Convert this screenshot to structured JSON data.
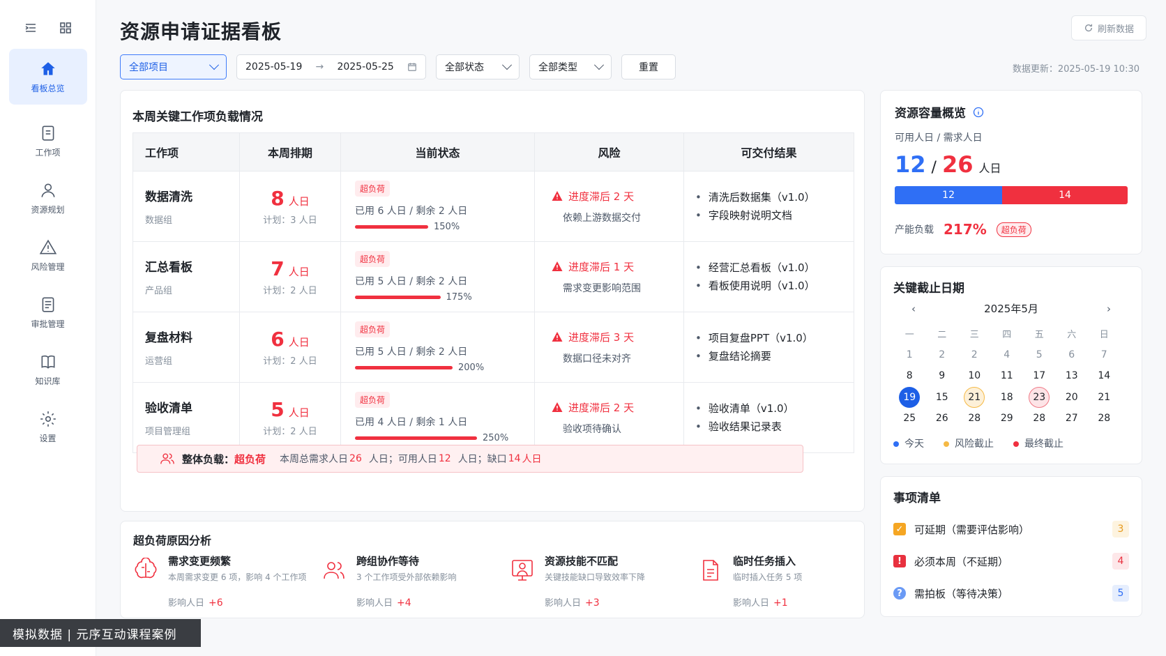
{
  "sidebar": {
    "items": [
      {
        "label": "看板总览",
        "icon": "home-icon"
      },
      {
        "label": "工作项",
        "icon": "file-icon"
      },
      {
        "label": "资源规划",
        "icon": "user-icon"
      },
      {
        "label": "风险管理",
        "icon": "warning-icon"
      },
      {
        "label": "审批管理",
        "icon": "document-icon"
      },
      {
        "label": "知识库",
        "icon": "book-icon"
      },
      {
        "label": "设置",
        "icon": "gear-icon"
      }
    ]
  },
  "header": {
    "title": "资源申请证据看板",
    "refresh_label": "刷新数据"
  },
  "filters": {
    "project": "全部项目",
    "date_start": "2025-05-19",
    "date_end": "2025-05-25",
    "status": "全部状态",
    "type": "全部类型",
    "reset_label": "重置",
    "updated": "数据更新：2025-05-19 10:30"
  },
  "workload": {
    "title": "本周关键工作项负载情况",
    "headers": [
      "工作项",
      "本周排期",
      "当前状态",
      "风险",
      "可交付结果"
    ],
    "rows": [
      {
        "name": "数据清洗",
        "team": "数据组",
        "days": "8",
        "unit": "人日",
        "plan": "计划：3 人日",
        "tag": "超负荷",
        "usage": "已用 6 人日 / 剩余 2 人日",
        "pct": "150%",
        "pct_value": 150,
        "risk": "进度滞后 2 天",
        "risk_detail": "依赖上游数据交付",
        "deliverables": [
          "清洗后数据集（v1.0）",
          "字段映射说明文档"
        ]
      },
      {
        "name": "汇总看板",
        "team": "产品组",
        "days": "7",
        "unit": "人日",
        "plan": "计划：2 人日",
        "tag": "超负荷",
        "usage": "已用 5 人日 / 剩余 2 人日",
        "pct": "175%",
        "pct_value": 175,
        "risk": "进度滞后 1 天",
        "risk_detail": "需求变更影响范围",
        "deliverables": [
          "经营汇总看板（v1.0）",
          "看板使用说明（v1.0）"
        ]
      },
      {
        "name": "复盘材料",
        "team": "运营组",
        "days": "6",
        "unit": "人日",
        "plan": "计划：2 人日",
        "tag": "超负荷",
        "usage": "已用 5 人日 / 剩余 2 人日",
        "pct": "200%",
        "pct_value": 200,
        "risk": "进度滞后 3 天",
        "risk_detail": "数据口径未对齐",
        "deliverables": [
          "项目复盘PPT（v1.0）",
          "复盘结论摘要"
        ]
      },
      {
        "name": "验收清单",
        "team": "项目管理组",
        "days": "5",
        "unit": "人日",
        "plan": "计划：2 人日",
        "tag": "超负荷",
        "usage": "已用 4 人日 / 剩余 1 人日",
        "pct": "250%",
        "pct_value": 250,
        "risk": "进度滞后 2 天",
        "risk_detail": "验收项待确认",
        "deliverables": [
          "验收清单（v1.0）",
          "验收结果记录表"
        ]
      }
    ],
    "summary": {
      "label": "整体负载：",
      "status": "超负荷",
      "t1": "本周总需求人日",
      "demand": "26",
      "t2": "人日；可用人日",
      "available": "12",
      "t3": "人日；缺口",
      "gap": "14",
      "t4": "人日"
    }
  },
  "analysis": {
    "title": "超负荷原因分析",
    "impact_label": "影响人日",
    "items": [
      {
        "name": "需求变更频繁",
        "desc": "本周需求变更 6 项，影响 4 个工作项",
        "impact": "+6",
        "icon": "brain-icon"
      },
      {
        "name": "跨组协作等待",
        "desc": "3 个工作项受外部依赖影响",
        "impact": "+4",
        "icon": "team-icon"
      },
      {
        "name": "资源技能不匹配",
        "desc": "关键技能缺口导致效率下降",
        "impact": "+3",
        "icon": "presenter-icon"
      },
      {
        "name": "临时任务插入",
        "desc": "临时插入任务 5 项",
        "impact": "+1",
        "icon": "task-file-icon"
      }
    ]
  },
  "capacity": {
    "title": "资源容量概览",
    "subtitle": "可用人日 / 需求人日",
    "available": "12",
    "sep": "/",
    "demand": "26",
    "unit": "人日",
    "bar_available": "12",
    "bar_gap": "14",
    "available_value": 12,
    "gap_value": 14,
    "load_label": "产能负载",
    "load": "217%",
    "load_tag": "超负荷",
    "colors": {
      "available": "#2f6ff5",
      "gap": "#f0303f"
    }
  },
  "calendar": {
    "title": "关键截止日期",
    "month": "2025年5月",
    "weekdays": [
      "一",
      "二",
      "三",
      "四",
      "五",
      "六",
      "日"
    ],
    "weeks": [
      [
        "1",
        "2",
        "2",
        "4",
        "5",
        "6",
        "7"
      ],
      [
        "8",
        "9",
        "10",
        "11",
        "17",
        "13",
        "14"
      ],
      [
        "19",
        "15",
        "21",
        "18",
        "23",
        "20",
        "21"
      ],
      [
        "25",
        "26",
        "28",
        "29",
        "28",
        "27",
        "28"
      ]
    ],
    "legend": [
      "今天",
      "风险截止",
      "最终截止"
    ]
  },
  "todo": {
    "title": "事项清单",
    "items": [
      {
        "label": "可延期（需要评估影响）",
        "count": "3",
        "icon": "checkbox-icon"
      },
      {
        "label": "必须本周（不延期）",
        "count": "4",
        "icon": "alert-icon"
      },
      {
        "label": "需拍板（等待决策）",
        "count": "5",
        "icon": "question-icon"
      }
    ]
  },
  "watermark": "模拟数据 | 元序互动课程案例"
}
